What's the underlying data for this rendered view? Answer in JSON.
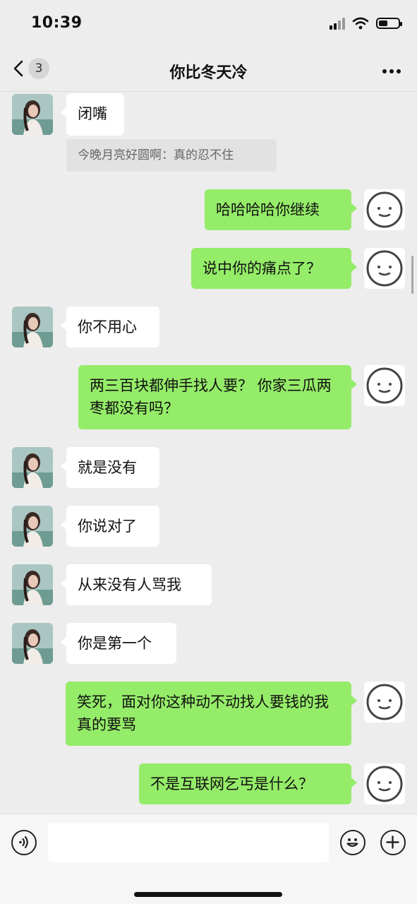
{
  "status_bar": {
    "time": "10:39"
  },
  "nav": {
    "back_badge": "3",
    "title": "你比冬天冷"
  },
  "messages": [
    {
      "side": "in",
      "text": "闭嘴"
    },
    {
      "type": "quote",
      "text": "今晚月亮好圆啊：真的忍不住"
    },
    {
      "side": "out",
      "text": "哈哈哈哈你继续"
    },
    {
      "side": "out",
      "text": "说中你的痛点了？"
    },
    {
      "side": "in",
      "text": "你不用心"
    },
    {
      "side": "out",
      "text": "两三百块都伸手找人要？ 你家三瓜两枣都没有吗？"
    },
    {
      "side": "in",
      "text": "就是没有"
    },
    {
      "side": "in",
      "text": "你说对了"
    },
    {
      "side": "in",
      "text": "从来没有人骂我"
    },
    {
      "side": "in",
      "text": "你是第一个"
    },
    {
      "side": "out",
      "text": "笑死，面对你这种动不动找人要钱的我真的要骂"
    },
    {
      "side": "out",
      "text": "不是互联网乞丐是什么？"
    }
  ],
  "icons": {
    "back": "chevron-left-icon",
    "more": "more-dots-icon",
    "voice": "voice-icon",
    "emoji": "emoji-icon",
    "add": "add-icon",
    "my_avatar": "smiley-face-icon",
    "her_avatar": "avatar-photo"
  },
  "colors": {
    "background": "#ededed",
    "outgoing_bubble": "#95ec69",
    "incoming_bubble": "#ffffff"
  }
}
